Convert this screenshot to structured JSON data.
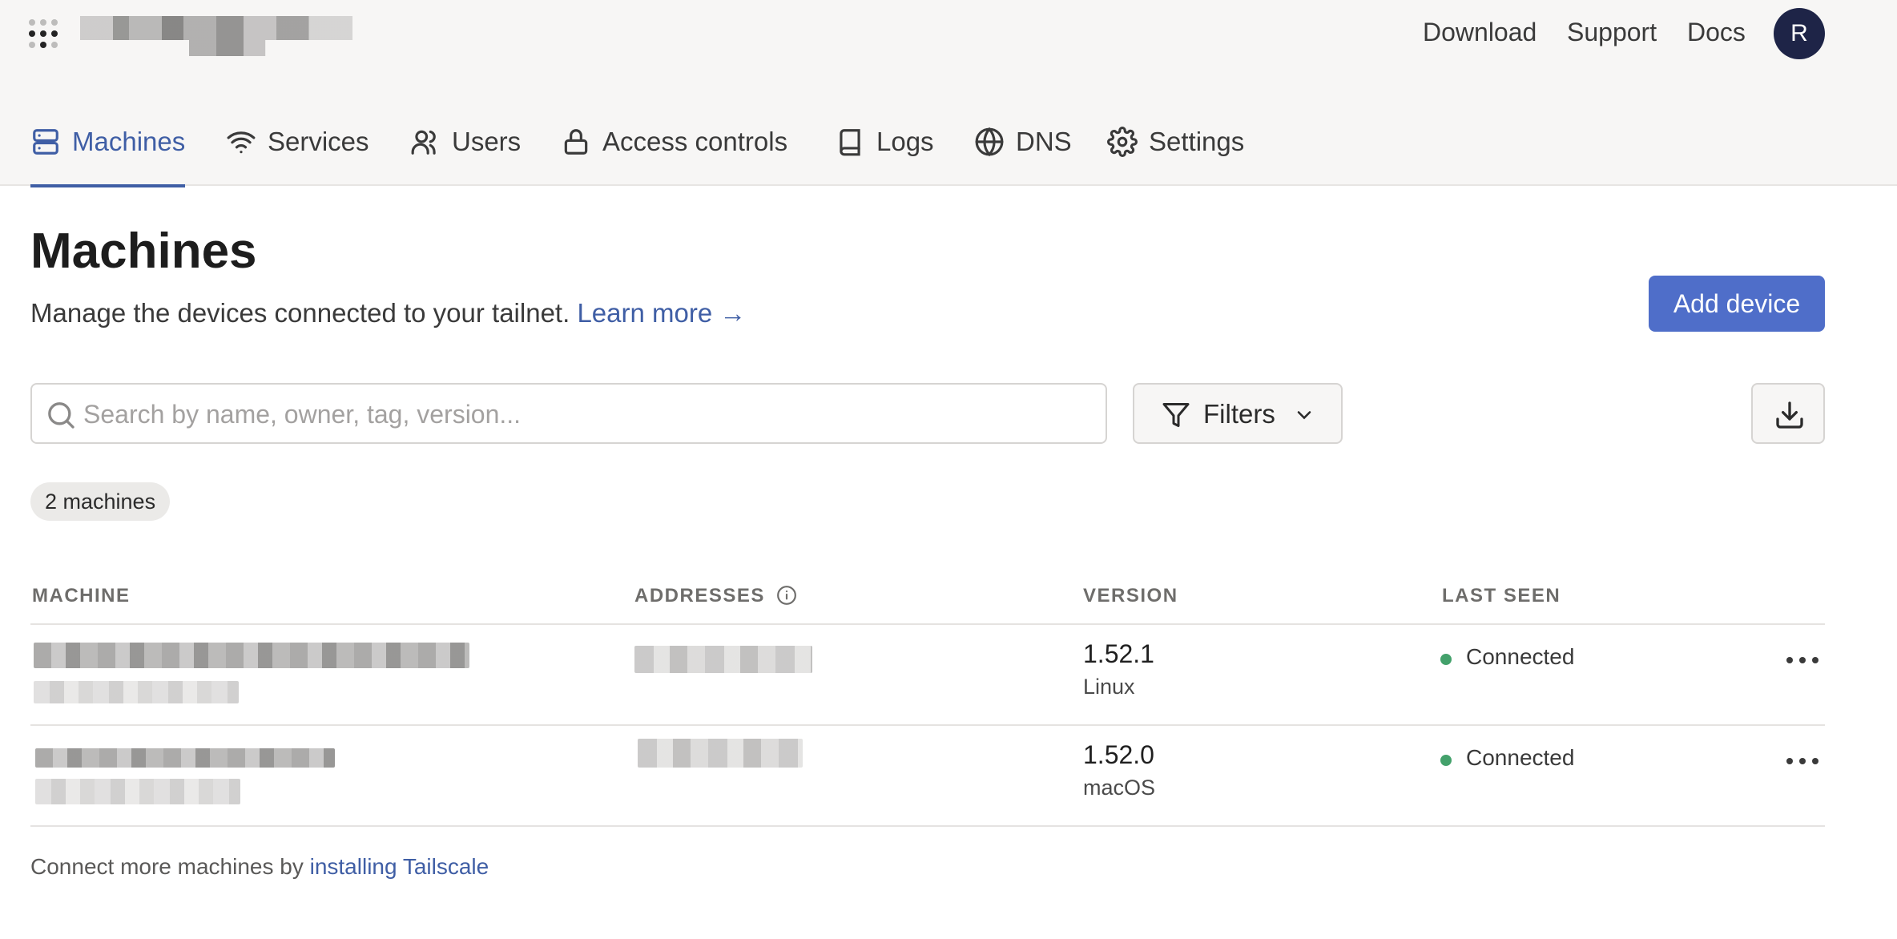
{
  "header": {
    "top_links": [
      "Download",
      "Support",
      "Docs"
    ],
    "avatar_initial": "R"
  },
  "tabs": [
    {
      "label": "Machines",
      "icon": "server-icon",
      "active": true
    },
    {
      "label": "Services",
      "icon": "wifi-icon",
      "active": false
    },
    {
      "label": "Users",
      "icon": "users-icon",
      "active": false
    },
    {
      "label": "Access controls",
      "icon": "lock-icon",
      "active": false
    },
    {
      "label": "Logs",
      "icon": "book-icon",
      "active": false
    },
    {
      "label": "DNS",
      "icon": "globe-icon",
      "active": false
    },
    {
      "label": "Settings",
      "icon": "gear-icon",
      "active": false
    }
  ],
  "page": {
    "title": "Machines",
    "description": "Manage the devices connected to your tailnet.",
    "learn_more": "Learn more →",
    "add_device_label": "Add device"
  },
  "search": {
    "placeholder": "Search by name, owner, tag, version...",
    "value": ""
  },
  "filters_label": "Filters",
  "machine_count": "2 machines",
  "table": {
    "headers": [
      "MACHINE",
      "ADDRESSES",
      "VERSION",
      "LAST SEEN"
    ],
    "rows": [
      {
        "version": "1.52.1",
        "os": "Linux",
        "status": "Connected"
      },
      {
        "version": "1.52.0",
        "os": "macOS",
        "status": "Connected"
      }
    ]
  },
  "footer": {
    "prefix": "Connect more machines by",
    "link": "installing Tailscale"
  },
  "colors": {
    "accent": "#3f5ea5",
    "primary_button": "#4f6ec9",
    "connected": "#43a16b",
    "avatar_bg": "#1e2447"
  }
}
